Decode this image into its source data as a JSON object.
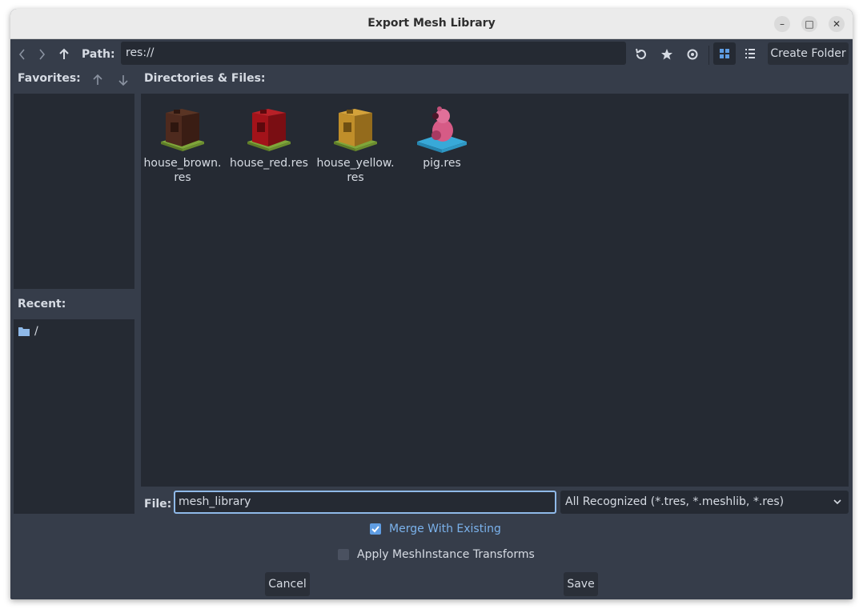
{
  "window": {
    "title": "Export Mesh Library",
    "controls": {
      "minimize": "–",
      "maximize": "□",
      "close": "✕"
    }
  },
  "toolbar": {
    "back_icon": "chevron-left",
    "forward_icon": "chevron-right",
    "up_icon": "arrow-up",
    "path_label": "Path:",
    "path_value": "res://",
    "refresh_icon": "refresh",
    "favorite_icon": "star",
    "show_hidden_icon": "eye",
    "grid_view_icon": "grid",
    "list_view_icon": "list",
    "create_folder_label": "Create Folder"
  },
  "favorites": {
    "label": "Favorites:",
    "move_up_icon": "arrow-up",
    "move_down_icon": "arrow-down",
    "items": []
  },
  "recent": {
    "label": "Recent:",
    "items": [
      {
        "icon": "folder",
        "label": "/"
      }
    ]
  },
  "files": {
    "label": "Directories & Files:",
    "items": [
      {
        "name_line1": "house_brown.",
        "name_line2": "res",
        "color": "#4e2a1e",
        "base": "#7fa63a"
      },
      {
        "name_line1": "house_red.res",
        "name_line2": "",
        "color": "#a3131a",
        "base": "#7fa63a"
      },
      {
        "name_line1": "house_yellow.",
        "name_line2": "res",
        "color": "#c08e2a",
        "base": "#7fa63a"
      },
      {
        "name_line1": "pig.res",
        "name_line2": "",
        "color": "#d65b86",
        "base": "#38a9d8"
      }
    ]
  },
  "file_field": {
    "label": "File:",
    "value": "mesh_library"
  },
  "filter": {
    "selected": "All Recognized (*.tres, *.meshlib, *.res)"
  },
  "options": {
    "merge_label": "Merge With Existing",
    "merge_checked": true,
    "apply_transforms_label": "Apply MeshInstance Transforms",
    "apply_transforms_checked": false
  },
  "actions": {
    "cancel_label": "Cancel",
    "save_label": "Save"
  },
  "colors": {
    "accent": "#5f9de3",
    "panel_bg": "#252a33",
    "window_bg": "#363d4a"
  }
}
